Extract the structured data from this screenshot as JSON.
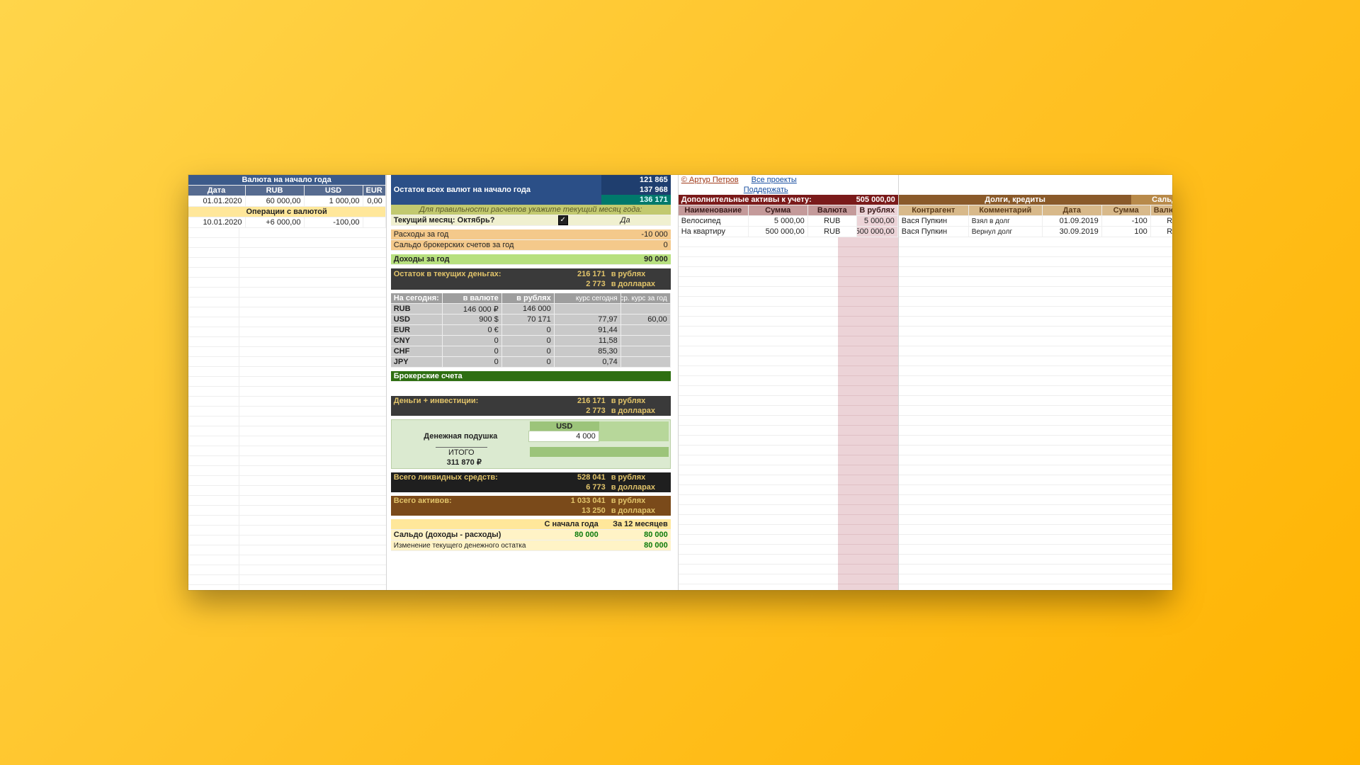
{
  "colA": {
    "title": "Валюта на начало года",
    "h": {
      "date": "Дата",
      "rub": "RUB",
      "usd": "USD",
      "eur": "EUR"
    },
    "row1": {
      "date": "01.01.2020",
      "rub": "60 000,00",
      "usd": "1 000,00",
      "eur": "0,00"
    },
    "ops_title": "Операции с валютой",
    "row2": {
      "date": "10.01.2020",
      "rub": "+6 000,00",
      "usd": "-100,00",
      "eur": ""
    }
  },
  "colB": {
    "top": {
      "title": "Остаток всех валют на начало года",
      "v1": "121 865",
      "v2": "137 968",
      "v3": "136 171"
    },
    "hint": "Для правильности расчетов укажите текущий месяц года:",
    "month_q": "Текущий месяц: Октябрь?",
    "month_a": "Да",
    "exp": {
      "label": "Расходы за год",
      "val": "-10 000"
    },
    "bal": {
      "label": "Сальдо брокерских счетов за год",
      "val": "0"
    },
    "inc": {
      "label": "Доходы за год",
      "val": "90 000"
    },
    "cur": {
      "label": "Остаток в текущих деньгах:",
      "rub": "216 171",
      "rub_l": "в рублях",
      "usd": "2 773",
      "usd_l": "в долларах"
    },
    "today": {
      "h": [
        "На сегодня:",
        "в валюте",
        "в рублях",
        "курс сегодня",
        "ср. курс за год"
      ],
      "rows": [
        [
          "RUB",
          "146 000 ₽",
          "146 000",
          "",
          ""
        ],
        [
          "USD",
          "900 $",
          "70 171",
          "77,97",
          "60,00"
        ],
        [
          "EUR",
          "0 €",
          "0",
          "91,44",
          ""
        ],
        [
          "CNY",
          "0",
          "0",
          "11,58",
          ""
        ],
        [
          "CHF",
          "0",
          "0",
          "85,30",
          ""
        ],
        [
          "JPY",
          "0",
          "0",
          "0,74",
          ""
        ]
      ]
    },
    "brok": "Брокерские счета",
    "moneyinv": {
      "label": "Деньги + инвестиции:",
      "rub": "216 171",
      "rub_l": "в рублях",
      "usd": "2 773",
      "usd_l": "в долларах"
    },
    "pillow": {
      "cur": "USD",
      "label": "Денежная подушка",
      "val": "4 000",
      "tot_l": "ИТОГО",
      "tot": "311 870 ₽"
    },
    "liq": {
      "label": "Всего ликвидных средств:",
      "rub": "528 041",
      "rub_l": "в рублях",
      "usd": "6 773",
      "usd_l": "в долларах"
    },
    "assets": {
      "label": "Всего активов:",
      "rub": "1 033 041",
      "rub_l": "в рублях",
      "usd": "13 250",
      "usd_l": "в долларах"
    },
    "bottom": {
      "h1": "С начала года",
      "h2": "За 12 месяцев",
      "r1l": "Сальдо (доходы - расходы)",
      "r1a": "80 000",
      "r1b": "80 000",
      "r2l": "Изменение текущего денежного остатка",
      "r2a": "",
      "r2b": "80 000"
    }
  },
  "colC": {
    "author": "© Артур Петров",
    "proj": "Все проекты",
    "support": "Поддержать",
    "title": "Дополнительные активы к учету:",
    "total": "505 000,00",
    "h": [
      "Наименование",
      "Сумма",
      "Валюта",
      "В рублях"
    ],
    "rows": [
      [
        "Велосипед",
        "5 000,00",
        "RUB",
        "5 000,00"
      ],
      [
        "На квартиру",
        "500 000,00",
        "RUB",
        "500 000,00"
      ]
    ]
  },
  "colD": {
    "title": "Долги, кредиты",
    "saldo_l": "Сальдо:",
    "h": [
      "Контрагент",
      "Комментарий",
      "Дата",
      "Сумма",
      "Валюта"
    ],
    "rows": [
      [
        "Вася Пупкин",
        "Взял в долг",
        "01.09.2019",
        "-100",
        "RUB"
      ],
      [
        "Вася Пупкин",
        "Вернул долг",
        "30.09.2019",
        "100",
        "RUB"
      ]
    ]
  }
}
